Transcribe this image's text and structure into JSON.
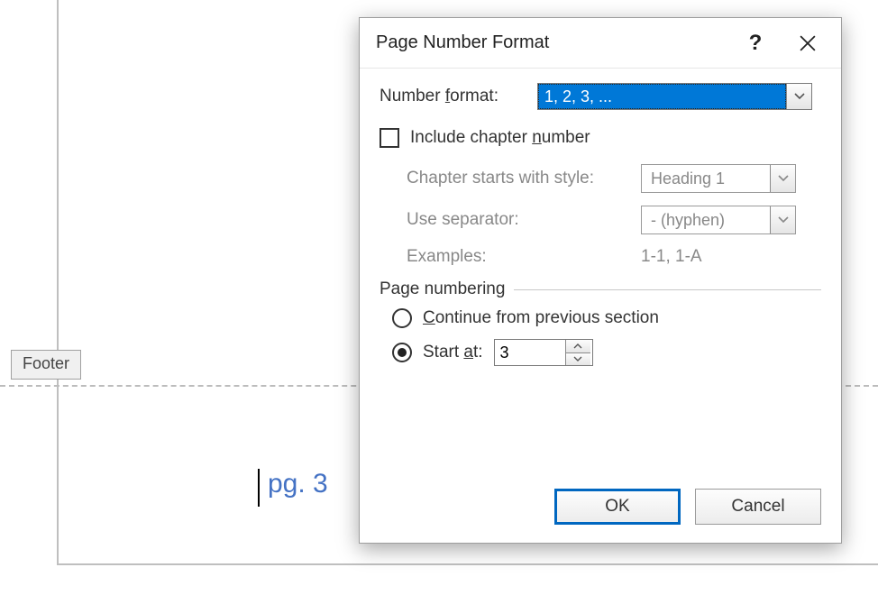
{
  "document": {
    "footer_tag": "Footer",
    "page_number_display": "pg. 3"
  },
  "dialog": {
    "title": "Page Number Format",
    "number_format_label": "Number format:",
    "number_format_value": "1, 2, 3, ...",
    "include_chapter_label": "Include chapter number",
    "include_chapter_checked": false,
    "chapter_style_label": "Chapter starts with style:",
    "chapter_style_value": "Heading 1",
    "separator_label": "Use separator:",
    "separator_value": "-   (hyphen)",
    "examples_label": "Examples:",
    "examples_value": "1-1, 1-A",
    "group_label": "Page numbering",
    "continue_label": "Continue from previous section",
    "start_at_label": "Start at:",
    "start_at_value": "3",
    "page_numbering_mode": "start_at",
    "ok_label": "OK",
    "cancel_label": "Cancel"
  }
}
